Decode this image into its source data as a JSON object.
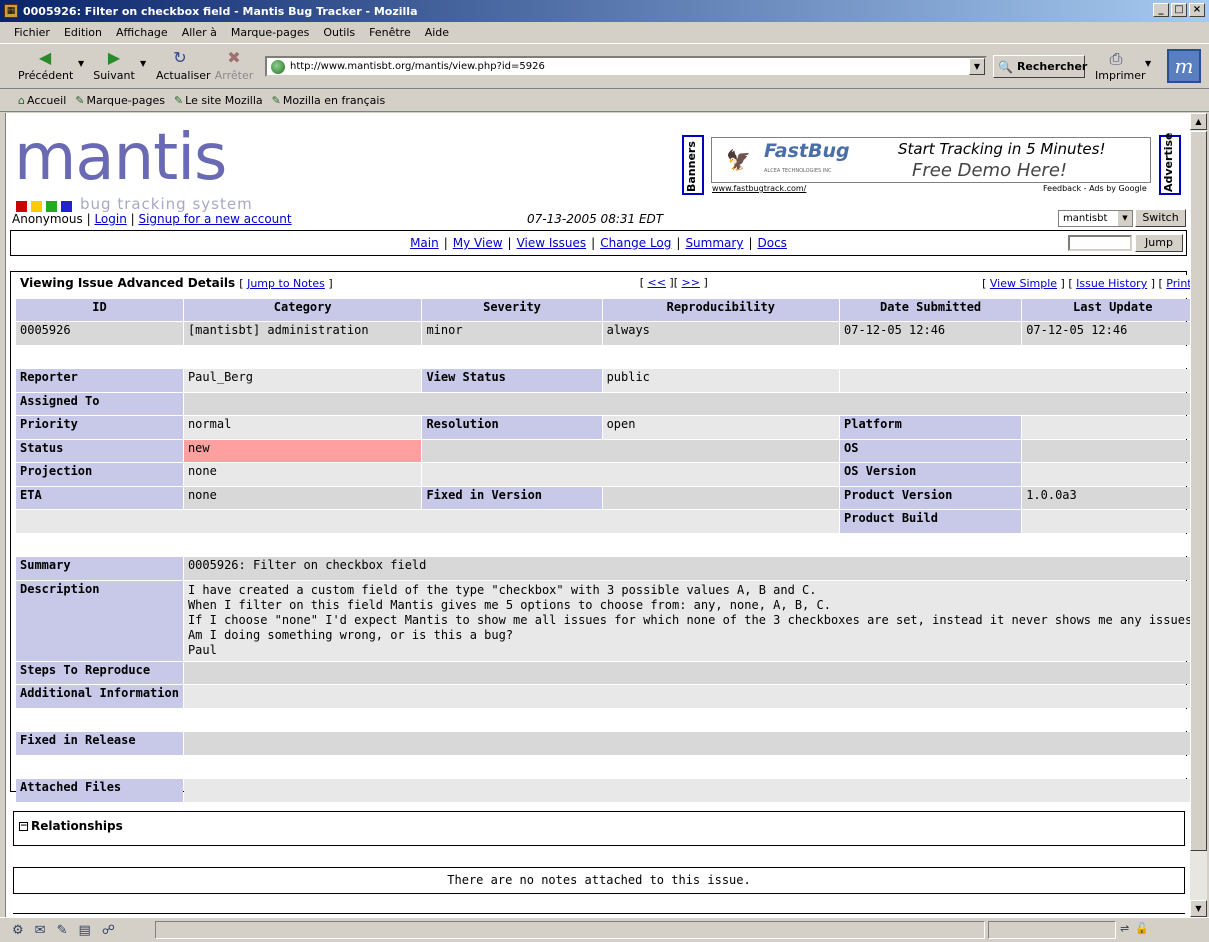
{
  "window": {
    "title": "0005926: Filter on checkbox field - Mantis Bug Tracker - Mozilla",
    "controls": [
      "_",
      "□",
      "×"
    ]
  },
  "menu": [
    "Fichier",
    "Edition",
    "Affichage",
    "Aller à",
    "Marque-pages",
    "Outils",
    "Fenêtre",
    "Aide"
  ],
  "toolbar": {
    "back": "Précédent",
    "forward": "Suivant",
    "reload": "Actualiser",
    "stop": "Arrêter",
    "url": "http://www.mantisbt.org/mantis/view.php?id=5926",
    "search": "Rechercher",
    "print": "Imprimer"
  },
  "bookmarks": [
    "Accueil",
    "Marque-pages",
    "Le site Mozilla",
    "Mozilla en français"
  ],
  "logo": {
    "word": "mantis",
    "tagline": "bug tracking system",
    "square_colors": [
      "#cc0000",
      "#ffcc00",
      "#22aa22",
      "#2222cc"
    ]
  },
  "ad": {
    "left_tab": "Banners",
    "right_tab": "Advertise",
    "brand": "FastBug",
    "brand_sub": "ALCEA TECHNOLOGIES INC",
    "headline1": "Start Tracking in 5 Minutes!",
    "headline2": "Free Demo Here!",
    "url": "www.fastbugtrack.com/",
    "feedback": "Feedback - Ads by Google"
  },
  "user": {
    "name": "Anonymous",
    "login": "Login",
    "signup": "Signup for a new account",
    "datetime": "07-13-2005 08:31 EDT",
    "project": "mantisbt",
    "switch": "Switch"
  },
  "nav": {
    "items": [
      "Main",
      "My View",
      "View Issues",
      "Change Log",
      "Summary",
      "Docs"
    ],
    "jump": "Jump"
  },
  "issue": {
    "heading": "Viewing Issue Advanced Details",
    "jump_to_notes": "Jump to Notes",
    "prev": "<<",
    "next": ">>",
    "view_simple": "View Simple",
    "history": "Issue History",
    "print": "Print",
    "columns": [
      "ID",
      "Category",
      "Severity",
      "Reproducibility",
      "Date Submitted",
      "Last Update"
    ],
    "values": [
      "0005926",
      "[mantisbt] administration",
      "minor",
      "always",
      "07-12-05 12:46",
      "07-12-05 12:46"
    ],
    "labels": {
      "reporter": "Reporter",
      "view_status": "View Status",
      "assigned": "Assigned To",
      "priority": "Priority",
      "resolution": "Resolution",
      "platform": "Platform",
      "status": "Status",
      "os": "OS",
      "projection": "Projection",
      "os_version": "OS Version",
      "eta": "ETA",
      "fixed_in": "Fixed in Version",
      "product_version": "Product Version",
      "product_build": "Product Build",
      "summary": "Summary",
      "description": "Description",
      "steps": "Steps To Reproduce",
      "additional": "Additional Information",
      "fixed_release": "Fixed in Release",
      "attached": "Attached Files"
    },
    "reporter": "Paul_Berg",
    "view_status": "public",
    "priority": "normal",
    "resolution": "open",
    "status": "new",
    "status_color": "#ffa0a0",
    "projection": "none",
    "eta": "none",
    "product_version": "1.0.0a3",
    "summary": "0005926: Filter on checkbox field",
    "description": [
      "I have created a custom field of the type \"checkbox\" with 3 possible values A, B and C.",
      "When I filter on this field Mantis gives me 5 options to choose from: any, none, A, B, C.",
      "If I choose \"none\" I'd expect Mantis to show me all issues for which none of the 3 checkboxes are set, instead it never shows me any issues.",
      "",
      "Am I doing something wrong, or is this a bug?",
      "",
      "Paul"
    ]
  },
  "relationships": "Relationships",
  "notes": "There are no notes attached to this issue."
}
